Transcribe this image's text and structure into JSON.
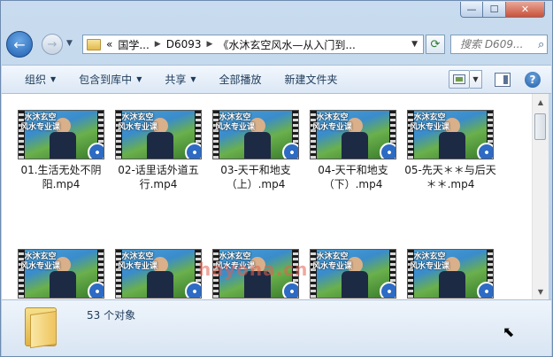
{
  "window": {
    "caption_min": "—",
    "caption_max": "☐",
    "caption_close": "✕"
  },
  "nav": {
    "back_glyph": "←",
    "forward_glyph": "→",
    "address_segments": [
      "«",
      "国学...",
      "D6093",
      "《水沐玄空风水—从入门到..."
    ],
    "refresh_glyph": "⟳",
    "search_placeholder": "搜索 D609..."
  },
  "toolbar": {
    "organize": "组织",
    "include_library": "包含到库中",
    "share": "共享",
    "play_all": "全部播放",
    "new_folder": "新建文件夹"
  },
  "thumbnail": {
    "title_line1": "水沐玄空",
    "title_line2": "风水专业课"
  },
  "files": [
    {
      "label": "01.生活无处不阴阳.mp4"
    },
    {
      "label": "02-话里话外道五行.mp4"
    },
    {
      "label": "03-天干和地支（上）.mp4"
    },
    {
      "label": "04-天干和地支（下）.mp4"
    },
    {
      "label": "05-先天＊＊与后天＊＊.mp4"
    },
    {
      "label": ""
    },
    {
      "label": ""
    },
    {
      "label": ""
    },
    {
      "label": ""
    },
    {
      "label": ""
    }
  ],
  "watermark": "hayona.cn",
  "status": {
    "count_text": "53 个对象"
  }
}
